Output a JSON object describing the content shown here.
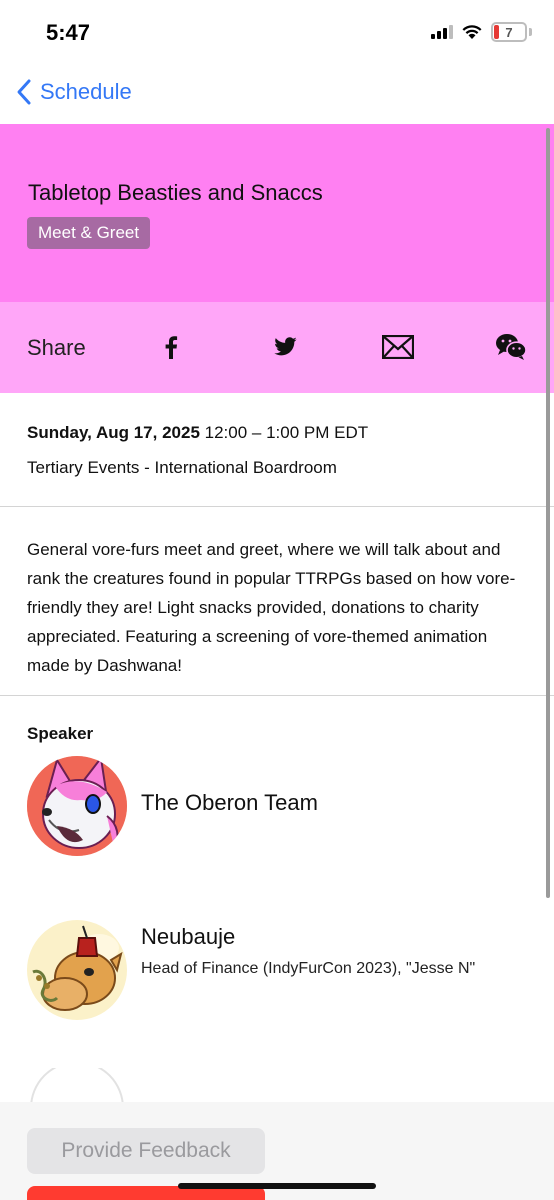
{
  "status_bar": {
    "time": "5:47",
    "battery": "7",
    "icons": [
      "signal-icon",
      "wifi-icon",
      "battery-icon"
    ]
  },
  "nav": {
    "back_label": "Schedule"
  },
  "event": {
    "title": "Tabletop Beasties and Snaccs",
    "tag": "Meet & Greet",
    "date": "Sunday, Aug 17, 2025",
    "time": "12:00 – 1:00 PM EDT",
    "location": "Tertiary Events - International Boardroom",
    "description": "General vore-furs meet and greet, where we will talk about and rank the creatures found in popular TTRPGs based on how vore-friendly they are! Light snacks provided, donations to charity appreciated. Featuring a screening of vore-themed animation made by Dashwana!"
  },
  "share": {
    "label": "Share",
    "buttons": [
      "facebook-icon",
      "twitter-icon",
      "email-icon",
      "wechat-icon"
    ]
  },
  "speakers": {
    "heading": "Speaker",
    "items": [
      {
        "name": "The Oberon Team",
        "role": ""
      },
      {
        "name": "Neubauje",
        "role": "Head of Finance (IndyFurCon 2023), \"Jesse N\""
      }
    ]
  },
  "footer": {
    "feedback_label": "Provide Feedback"
  },
  "colors": {
    "hero": "#ff80f2",
    "share_bar": "#ffa6f8",
    "tag": "#a76aa3",
    "link": "#3478f6",
    "alert": "#ff3b30"
  }
}
